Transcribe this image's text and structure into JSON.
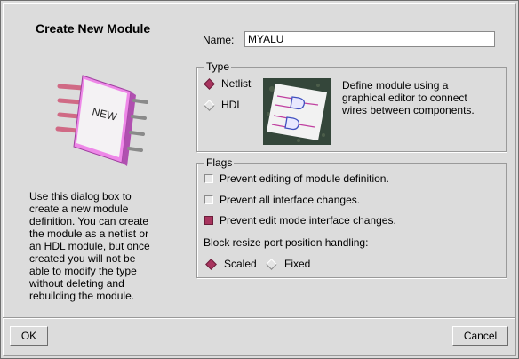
{
  "dialog": {
    "title": "Create New Module",
    "description": "Use this dialog box to\ncreate a new module\ndefinition.  You can create\nthe module as a netlist or\nan HDL module, but once\ncreated you will not be\nable to modify the type\nwithout deleting and\nrebuilding the module.",
    "new_badge_text": "NEW"
  },
  "name_field": {
    "label": "Name:",
    "value": "MYALU"
  },
  "type_group": {
    "title": "Type",
    "options": [
      {
        "label": "Netlist",
        "selected": true
      },
      {
        "label": "HDL",
        "selected": false
      }
    ],
    "description": "Define module using a\ngraphical editor to connect\nwires between components."
  },
  "flags_group": {
    "title": "Flags",
    "checkboxes": [
      {
        "label": "Prevent editing of module definition.",
        "checked": false
      },
      {
        "label": "Prevent all interface changes.",
        "checked": false
      },
      {
        "label": "Prevent edit mode interface changes.",
        "checked": true
      }
    ],
    "resize_label": "Block resize port position handling:",
    "resize_options": [
      {
        "label": "Scaled",
        "selected": true
      },
      {
        "label": "Fixed",
        "selected": false
      }
    ]
  },
  "buttons": {
    "ok": "OK",
    "cancel": "Cancel"
  },
  "colors": {
    "background": "#dcdcdc",
    "accent": "#a8345e"
  }
}
